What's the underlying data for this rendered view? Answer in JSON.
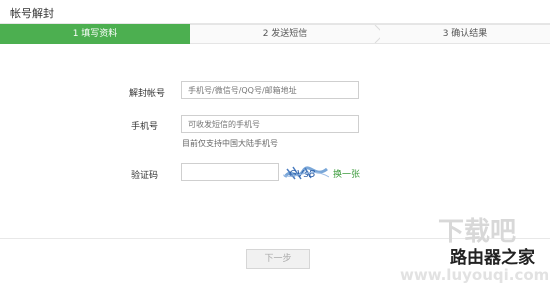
{
  "window": {
    "title": "帐号解封"
  },
  "steps": [
    {
      "label": "1 填写资料"
    },
    {
      "label": "2 发送短信"
    },
    {
      "label": "3 确认结果"
    }
  ],
  "form": {
    "account": {
      "label": "解封帐号",
      "placeholder": "手机号/微信号/QQ号/邮箱地址",
      "value": ""
    },
    "phone": {
      "label": "手机号",
      "placeholder": "可收发短信的手机号",
      "value": "",
      "hint": "目前仅支持中国大陆手机号"
    },
    "captcha": {
      "label": "验证码",
      "value": "",
      "image_text": "GVsB",
      "refresh_label": "换一张"
    }
  },
  "actions": {
    "next_label": "下一步"
  },
  "watermark": {
    "line1": "下载吧",
    "line2": "路由器之家",
    "url": "www.luyouqi.com"
  },
  "colors": {
    "accent": "#4caf50",
    "link": "#3a9a3a"
  }
}
